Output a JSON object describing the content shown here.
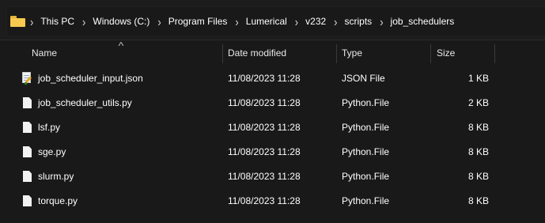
{
  "address_bar": {
    "folder_icon": "folder-icon",
    "breadcrumbs": [
      "This PC",
      "Windows (C:)",
      "Program Files",
      "Lumerical",
      "v232",
      "scripts",
      "job_schedulers"
    ],
    "separator_icon": "chevron-right-icon"
  },
  "columns": {
    "name": "Name",
    "date_modified": "Date modified",
    "type": "Type",
    "size": "Size",
    "sort_indicator_icon": "sort-up-icon"
  },
  "files": [
    {
      "name": "job_scheduler_input.json",
      "date": "11/08/2023 11:28",
      "type": "JSON File",
      "size": "1 KB",
      "icon": "json-file-icon"
    },
    {
      "name": "job_scheduler_utils.py",
      "date": "11/08/2023 11:28",
      "type": "Python.File",
      "size": "2 KB",
      "icon": "file-icon"
    },
    {
      "name": "lsf.py",
      "date": "11/08/2023 11:28",
      "type": "Python.File",
      "size": "8 KB",
      "icon": "file-icon"
    },
    {
      "name": "sge.py",
      "date": "11/08/2023 11:28",
      "type": "Python.File",
      "size": "8 KB",
      "icon": "file-icon"
    },
    {
      "name": "slurm.py",
      "date": "11/08/2023 11:28",
      "type": "Python.File",
      "size": "8 KB",
      "icon": "file-icon"
    },
    {
      "name": "torque.py",
      "date": "11/08/2023 11:28",
      "type": "Python.File",
      "size": "8 KB",
      "icon": "file-icon"
    }
  ],
  "colors": {
    "background": "#191919",
    "folder": "#f7ca4f",
    "text": "#ffffff"
  }
}
